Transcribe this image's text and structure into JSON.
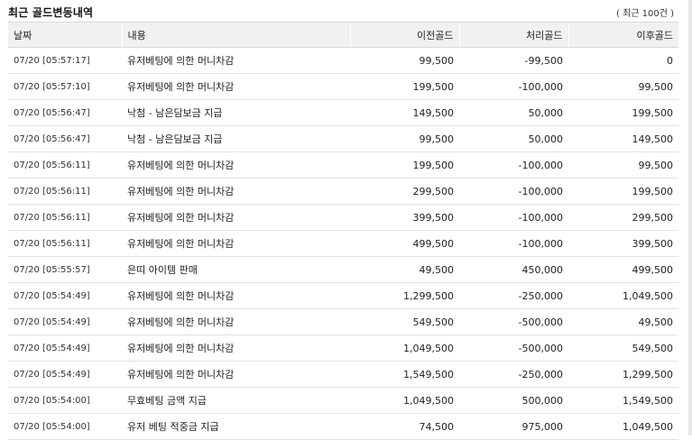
{
  "title": "최근 골드변동내역",
  "count_label": "( 최근 100건 )",
  "columns": [
    "날짜",
    "내용",
    "이전골드",
    "처리골드",
    "이후골드"
  ],
  "rows": [
    {
      "date": "07/20 [05:57:17]",
      "desc": "유저베팅에 의한 머니차감",
      "before": "99,500",
      "change": "-99,500",
      "after": "0"
    },
    {
      "date": "07/20 [05:57:10]",
      "desc": "유저베팅에 의한 머니차감",
      "before": "199,500",
      "change": "-100,000",
      "after": "99,500"
    },
    {
      "date": "07/20 [05:56:47]",
      "desc": "낙첨 - 남은담보금 지급",
      "before": "149,500",
      "change": "50,000",
      "after": "199,500"
    },
    {
      "date": "07/20 [05:56:47]",
      "desc": "낙첨 - 남은담보금 지급",
      "before": "99,500",
      "change": "50,000",
      "after": "149,500"
    },
    {
      "date": "07/20 [05:56:11]",
      "desc": "유저베팅에 의한 머니차감",
      "before": "199,500",
      "change": "-100,000",
      "after": "99,500"
    },
    {
      "date": "07/20 [05:56:11]",
      "desc": "유저베팅에 의한 머니차감",
      "before": "299,500",
      "change": "-100,000",
      "after": "199,500"
    },
    {
      "date": "07/20 [05:56:11]",
      "desc": "유저베팅에 의한 머니차감",
      "before": "399,500",
      "change": "-100,000",
      "after": "299,500"
    },
    {
      "date": "07/20 [05:56:11]",
      "desc": "유저베팅에 의한 머니차감",
      "before": "499,500",
      "change": "-100,000",
      "after": "399,500"
    },
    {
      "date": "07/20 [05:55:57]",
      "desc": "은띠 아이템 판매",
      "before": "49,500",
      "change": "450,000",
      "after": "499,500"
    },
    {
      "date": "07/20 [05:54:49]",
      "desc": "유저베팅에 의한 머니차감",
      "before": "1,299,500",
      "change": "-250,000",
      "after": "1,049,500"
    },
    {
      "date": "07/20 [05:54:49]",
      "desc": "유저베팅에 의한 머니차감",
      "before": "549,500",
      "change": "-500,000",
      "after": "49,500"
    },
    {
      "date": "07/20 [05:54:49]",
      "desc": "유저베팅에 의한 머니차감",
      "before": "1,049,500",
      "change": "-500,000",
      "after": "549,500"
    },
    {
      "date": "07/20 [05:54:49]",
      "desc": "유저베팅에 의한 머니차감",
      "before": "1,549,500",
      "change": "-250,000",
      "after": "1,299,500"
    },
    {
      "date": "07/20 [05:54:00]",
      "desc": "무효베팅 금액 지급",
      "before": "1,049,500",
      "change": "500,000",
      "after": "1,549,500"
    },
    {
      "date": "07/20 [05:54:00]",
      "desc": "유저 베팅 적중금 지급",
      "before": "74,500",
      "change": "975,000",
      "after": "1,049,500"
    }
  ]
}
